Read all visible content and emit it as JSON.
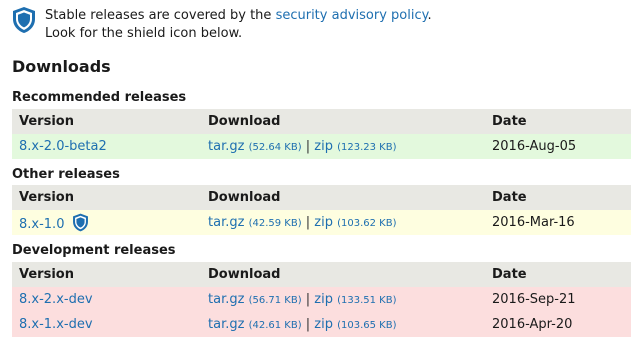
{
  "notice": {
    "text_before": "Stable releases are covered by the ",
    "link_text": "security advisory policy",
    "text_after": ".",
    "line2": "Look for the shield icon below."
  },
  "page_heading": "Downloads",
  "headers": {
    "version": "Version",
    "download": "Download",
    "date": "Date"
  },
  "separator": "|",
  "colors": {
    "link": "#1e6fb0",
    "recommended_row": "#e3f9dd",
    "other_row": "#fefee0",
    "dev_row": "#fcdede",
    "header_row": "#e8e8e3",
    "shield_fill": "#1e6fb0"
  },
  "sections": [
    {
      "title": "Recommended releases",
      "rows": [
        {
          "version": "8.x-2.0-beta2",
          "targz": "tar.gz",
          "targz_size": "(52.64 KB)",
          "zip": "zip",
          "zip_size": "(123.23 KB)",
          "date": "2016-Aug-05"
        }
      ]
    },
    {
      "title": "Other releases",
      "rows": [
        {
          "version": "8.x-1.0",
          "shield_icon": "shield-icon",
          "targz": "tar.gz",
          "targz_size": "(42.59 KB)",
          "zip": "zip",
          "zip_size": "(103.62 KB)",
          "date": "2016-Mar-16"
        }
      ]
    },
    {
      "title": "Development releases",
      "rows": [
        {
          "version": "8.x-2.x-dev",
          "targz": "tar.gz",
          "targz_size": "(56.71 KB)",
          "zip": "zip",
          "zip_size": "(133.51 KB)",
          "date": "2016-Sep-21"
        },
        {
          "version": "8.x-1.x-dev",
          "targz": "tar.gz",
          "targz_size": "(42.61 KB)",
          "zip": "zip",
          "zip_size": "(103.65 KB)",
          "date": "2016-Apr-20"
        }
      ]
    }
  ]
}
